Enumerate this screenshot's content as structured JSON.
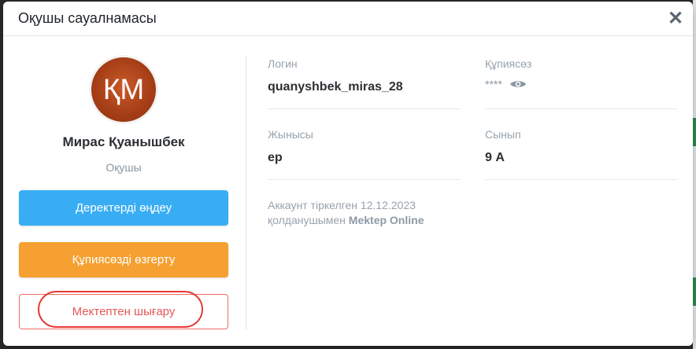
{
  "modal": {
    "title": "Оқушы сауалнамасы",
    "close_symbol": "✕"
  },
  "profile": {
    "initials": "ҚМ",
    "name": "Мирас Қуанышбек",
    "role": "Оқушы",
    "avatar_color": "#B64A1F"
  },
  "actions": {
    "edit_label": "Деректерді өңдеу",
    "password_label": "Құпиясөзді өзгерту",
    "expel_label": "Мектептен шығару"
  },
  "details": {
    "login_label": "Логин",
    "login_value": "quanyshbek_miras_28",
    "password_label": "Құпиясөз",
    "password_mask": "****",
    "gender_label": "Жынысы",
    "gender_value": "ер",
    "class_label": "Сынып",
    "class_value": "9 А",
    "registered_prefix": "Аккаунт тіркелген 12.12.2023",
    "registered_suffix": "қолданушымен",
    "registered_by": "Mektep Online"
  },
  "colors": {
    "primary_button": "#38ADF4",
    "warning_button": "#F5A030",
    "danger_outline": "#EF6B67",
    "highlight_ring": "#E53935"
  },
  "icons": {
    "close": "close-icon",
    "password_visibility": "eye-icon"
  }
}
